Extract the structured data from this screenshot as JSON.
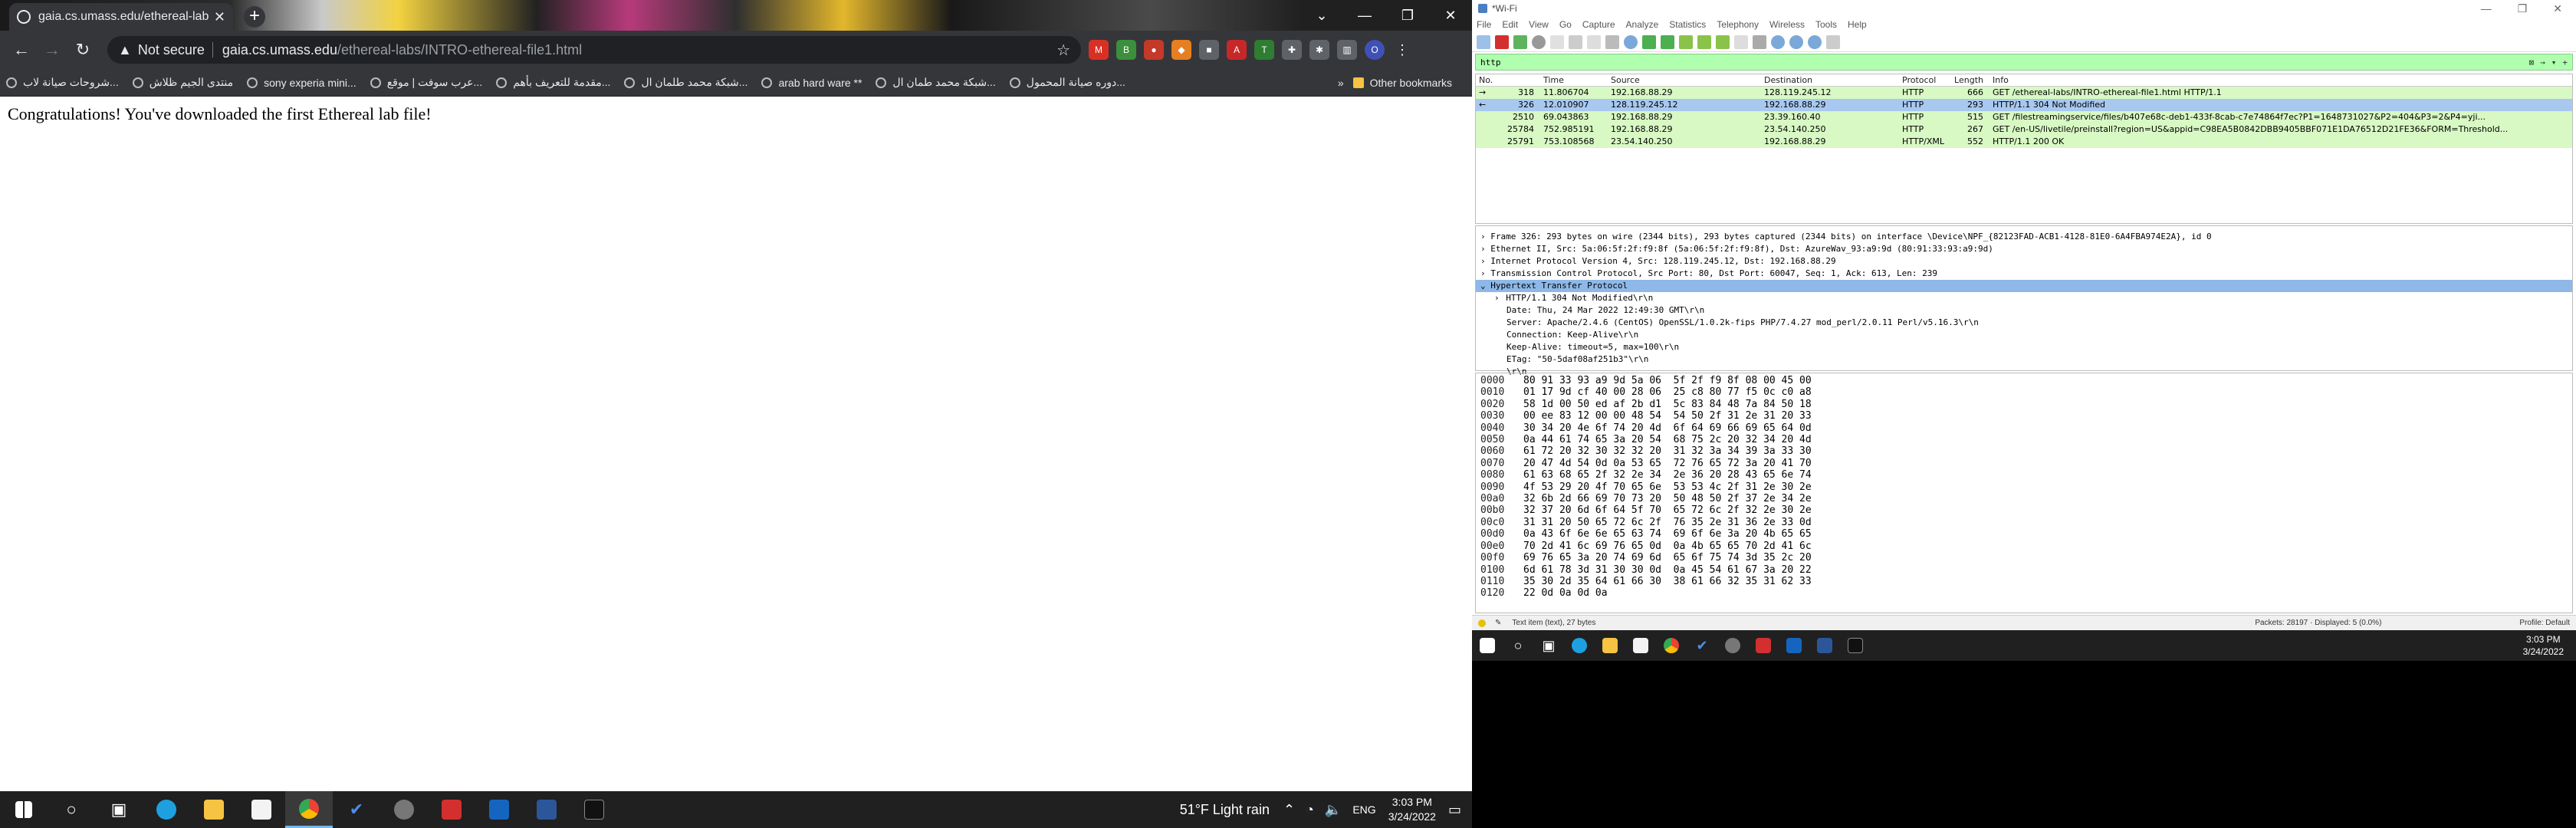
{
  "browser": {
    "tab_title": "gaia.cs.umass.edu/ethereal-labs/",
    "address": {
      "not_secure": "Not secure",
      "host": "gaia.cs.umass.edu",
      "path": "/ethereal-labs/INTRO-ethereal-file1.html"
    },
    "profile_initial": "O",
    "bookmarks": [
      "شروحات صيانة لاب...",
      "منتدى الجيم ظلاش",
      "sony experia mini...",
      "عرب سوفت | موقع...",
      "مقدمة للتعريف بأهم...",
      "شبكة محمد طلمان ال...",
      "arab hard ware **",
      "شبكة محمد طمان ال...",
      "دوره صيانة المحمول..."
    ],
    "other_bookmarks": "Other bookmarks",
    "page_text": "Congratulations! You've downloaded the first Ethereal lab file!"
  },
  "taskbar_left": {
    "weather": "51°F  Light rain",
    "lang": "ENG",
    "time": "3:03 PM",
    "date": "3/24/2022"
  },
  "wireshark": {
    "title": "*Wi-Fi",
    "menu": [
      "File",
      "Edit",
      "View",
      "Go",
      "Capture",
      "Analyze",
      "Statistics",
      "Telephony",
      "Wireless",
      "Tools",
      "Help"
    ],
    "filter": "http",
    "columns": [
      "No.",
      "Time",
      "Source",
      "Destination",
      "Protocol",
      "Length",
      "Info"
    ],
    "packets": [
      {
        "no": "318",
        "time": "11.806704",
        "src": "192.168.88.29",
        "dst": "128.119.245.12",
        "proto": "HTTP",
        "len": "666",
        "info": "GET /ethereal-labs/INTRO-ethereal-file1.html HTTP/1.1"
      },
      {
        "no": "326",
        "time": "12.010907",
        "src": "128.119.245.12",
        "dst": "192.168.88.29",
        "proto": "HTTP",
        "len": "293",
        "info": "HTTP/1.1 304 Not Modified"
      },
      {
        "no": "2510",
        "time": "69.043863",
        "src": "192.168.88.29",
        "dst": "23.39.160.40",
        "proto": "HTTP",
        "len": "515",
        "info": "GET /filestreamingservice/files/b407e68c-deb1-433f-8cab-c7e74864f7ec?P1=1648731027&P2=404&P3=2&P4=yji..."
      },
      {
        "no": "25784",
        "time": "752.985191",
        "src": "192.168.88.29",
        "dst": "23.54.140.250",
        "proto": "HTTP",
        "len": "267",
        "info": "GET /en-US/livetile/preinstall?region=US&appid=C98EA5B0842DBB9405BBF071E1DA76512D21FE36&FORM=Threshold..."
      },
      {
        "no": "25791",
        "time": "753.108568",
        "src": "23.54.140.250",
        "dst": "192.168.88.29",
        "proto": "HTTP/XML",
        "len": "552",
        "info": "HTTP/1.1 200 OK"
      }
    ],
    "details": [
      "Frame 326: 293 bytes on wire (2344 bits), 293 bytes captured (2344 bits) on interface \\Device\\NPF_{82123FAD-ACB1-4128-81E0-6A4FBA974E2A}, id 0",
      "Ethernet II, Src: 5a:06:5f:2f:f9:8f (5a:06:5f:2f:f9:8f), Dst: AzureWav_93:a9:9d (80:91:33:93:a9:9d)",
      "Internet Protocol Version 4, Src: 128.119.245.12, Dst: 192.168.88.29",
      "Transmission Control Protocol, Src Port: 80, Dst Port: 60047, Seq: 1, Ack: 613, Len: 239",
      "Hypertext Transfer Protocol",
      "HTTP/1.1 304 Not Modified\\r\\n",
      "Date: Thu, 24 Mar 2022 12:49:30 GMT\\r\\n",
      "Server: Apache/2.4.6 (CentOS) OpenSSL/1.0.2k-fips PHP/7.4.27 mod_perl/2.0.11 Perl/v5.16.3\\r\\n",
      "Connection: Keep-Alive\\r\\n",
      "Keep-Alive: timeout=5, max=100\\r\\n",
      "ETag: \"50-5daf08af251b3\"\\r\\n",
      "\\r\\n"
    ],
    "hex": [
      [
        "0000",
        "80 91 33 93 a9 9d 5a 06  5f 2f f9 8f 08 00 45 00"
      ],
      [
        "0010",
        "01 17 9d cf 40 00 28 06  25 c8 80 77 f5 0c c0 a8"
      ],
      [
        "0020",
        "58 1d 00 50 ed af 2b d1  5c 83 84 48 7a 84 50 18"
      ],
      [
        "0030",
        "00 ee 83 12 00 00 48 54  54 50 2f 31 2e 31 20 33"
      ],
      [
        "0040",
        "30 34 20 4e 6f 74 20 4d  6f 64 69 66 69 65 64 0d"
      ],
      [
        "0050",
        "0a 44 61 74 65 3a 20 54  68 75 2c 20 32 34 20 4d"
      ],
      [
        "0060",
        "61 72 20 32 30 32 32 20  31 32 3a 34 39 3a 33 30"
      ],
      [
        "0070",
        "20 47 4d 54 0d 0a 53 65  72 76 65 72 3a 20 41 70"
      ],
      [
        "0080",
        "61 63 68 65 2f 32 2e 34  2e 36 20 28 43 65 6e 74"
      ],
      [
        "0090",
        "4f 53 29 20 4f 70 65 6e  53 53 4c 2f 31 2e 30 2e"
      ],
      [
        "00a0",
        "32 6b 2d 66 69 70 73 20  50 48 50 2f 37 2e 34 2e"
      ],
      [
        "00b0",
        "32 37 20 6d 6f 64 5f 70  65 72 6c 2f 32 2e 30 2e"
      ],
      [
        "00c0",
        "31 31 20 50 65 72 6c 2f  76 35 2e 31 36 2e 33 0d"
      ],
      [
        "00d0",
        "0a 43 6f 6e 6e 65 63 74  69 6f 6e 3a 20 4b 65 65"
      ],
      [
        "00e0",
        "70 2d 41 6c 69 76 65 0d  0a 4b 65 65 70 2d 41 6c"
      ],
      [
        "00f0",
        "69 76 65 3a 20 74 69 6d  65 6f 75 74 3d 35 2c 20"
      ],
      [
        "0100",
        "6d 61 78 3d 31 30 30 0d  0a 45 54 61 67 3a 20 22"
      ],
      [
        "0110",
        "35 30 2d 35 64 61 66 30  38 61 66 32 35 31 62 33"
      ],
      [
        "0120",
        "22 0d 0a 0d 0a"
      ]
    ],
    "status_left": "Text item (text), 27 bytes",
    "status_packets": "Packets: 28197 · Displayed: 5 (0.0%)",
    "status_profile": "Profile: Default"
  },
  "taskbar_right": {
    "time": "3:03 PM",
    "date": "3/24/2022"
  }
}
